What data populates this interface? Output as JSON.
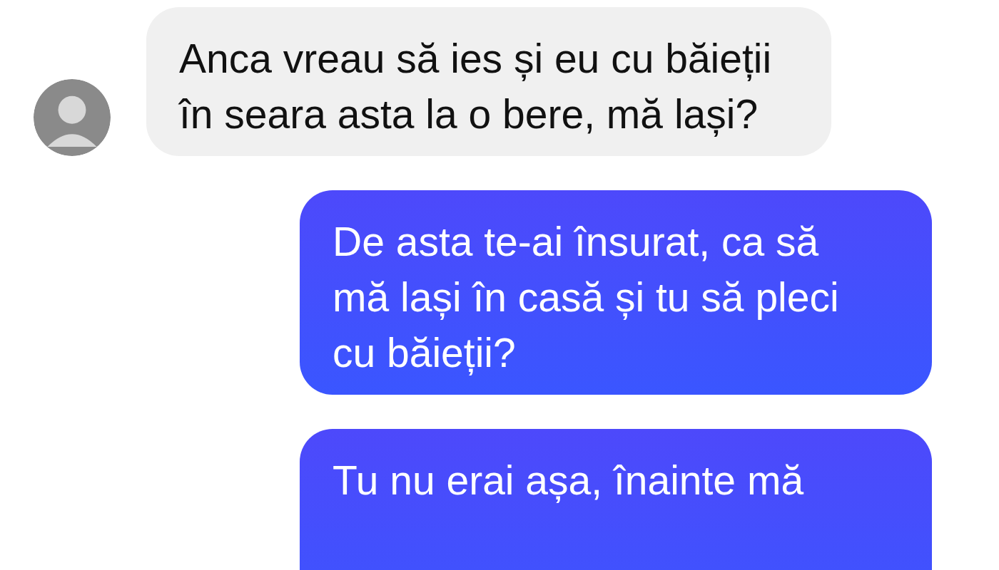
{
  "messages": [
    {
      "kind": "incoming",
      "text": "Anca vreau să ies și eu cu băieții în seara asta la o bere, mă lași?",
      "avatar": true
    },
    {
      "kind": "outgoing",
      "text": "De asta te-ai însurat, ca să mă lași în casă și tu să pleci cu băieții?"
    },
    {
      "kind": "outgoing",
      "text": "Tu nu erai așa, înainte mă",
      "cut": true
    }
  ]
}
